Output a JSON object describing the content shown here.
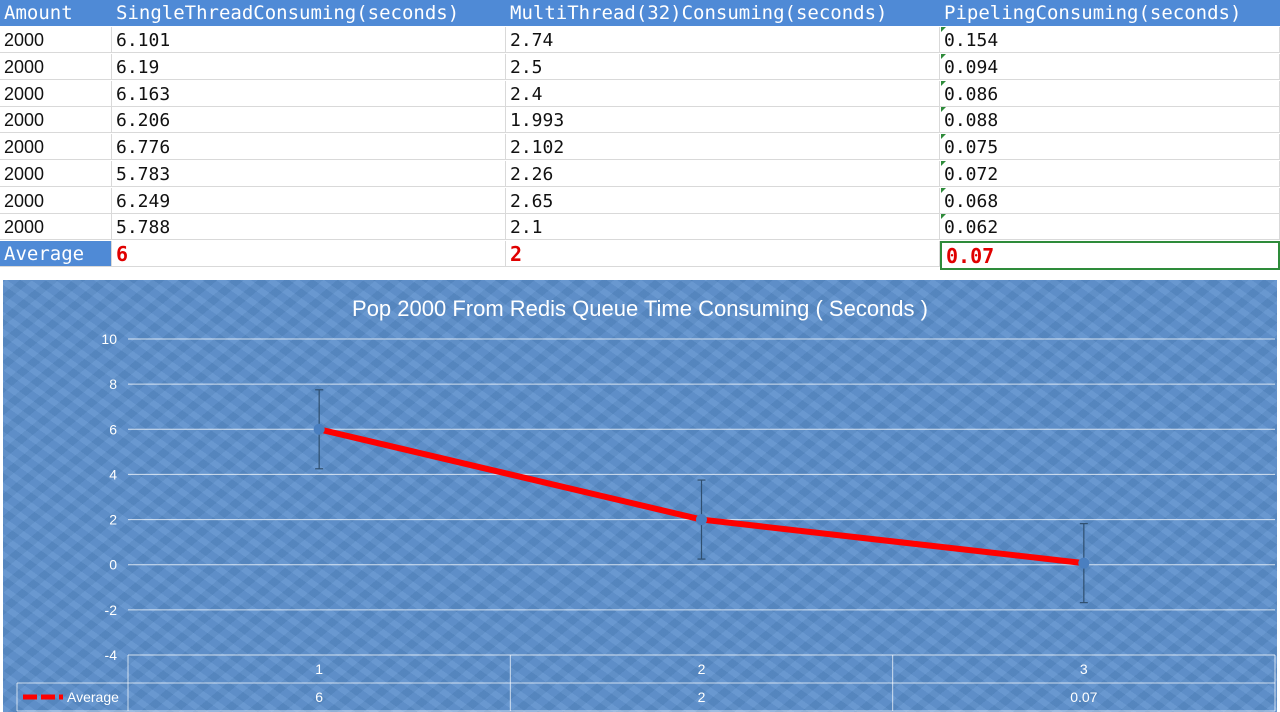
{
  "sheet": {
    "headers": [
      "Amount",
      "SingleThreadConsuming(seconds)",
      "MultiThread(32)Consuming(seconds)",
      "PipelingConsuming(seconds)"
    ],
    "rows": [
      [
        "2000",
        "6.101",
        "2.74",
        "0.154"
      ],
      [
        "2000",
        "6.19",
        "2.5",
        "0.094"
      ],
      [
        "2000",
        "6.163",
        "2.4",
        "0.086"
      ],
      [
        "2000",
        "6.206",
        "1.993",
        "0.088"
      ],
      [
        "2000",
        "6.776",
        "2.102",
        "0.075"
      ],
      [
        "2000",
        "5.783",
        "2.26",
        "0.072"
      ],
      [
        "2000",
        "6.249",
        "2.65",
        "0.068"
      ],
      [
        "2000",
        "5.788",
        "2.1",
        "0.062"
      ]
    ],
    "average": {
      "label": "Average",
      "single": "6",
      "multi": "2",
      "pipeline": "0.07"
    }
  },
  "colors": {
    "header_bg": "#4f8ad6",
    "chart_bg": "#5b8fcc",
    "series": "#ff0000",
    "avg_text": "#e00000",
    "selection": "#2e8b3a"
  },
  "chart_data": {
    "type": "line",
    "title": "Pop 2000 From Redis Queue Time Consuming ( Seconds )",
    "categories": [
      "1",
      "2",
      "3"
    ],
    "series": [
      {
        "name": "Average",
        "values": [
          6,
          2,
          0.07
        ],
        "data_table_labels": [
          "6",
          "2",
          "0.07"
        ],
        "error_bar": 1.75
      }
    ],
    "ylim": [
      -4,
      10
    ],
    "yticks": [
      10,
      8,
      6,
      4,
      2,
      0,
      -2,
      -4
    ],
    "grid": true,
    "data_table": true,
    "legend_placement": "in-data-table"
  }
}
